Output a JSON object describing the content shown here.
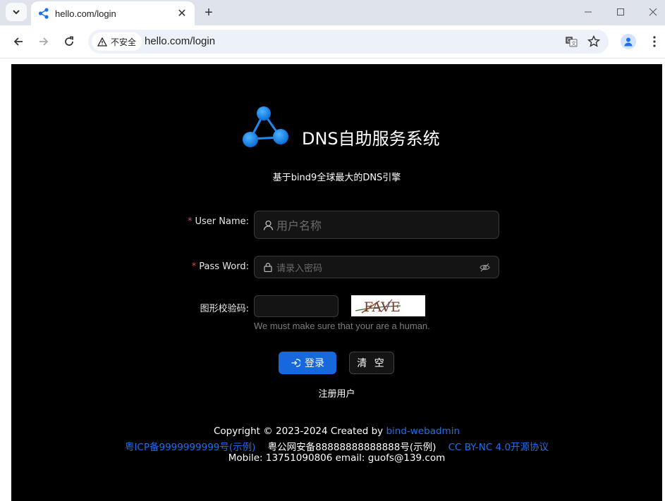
{
  "browser": {
    "tab_title": "hello.com/login",
    "security_label": "不安全",
    "url": "hello.com/login"
  },
  "login": {
    "brand": "DNS自助服务系统",
    "subtitle": "基于bind9全球最大的DNS引擎",
    "username_label": "User Name:",
    "username_placeholder": "用户名称",
    "password_label": "Pass Word:",
    "password_placeholder": "请录入密码",
    "captcha_label": "图形校验码:",
    "captcha_text": "FAVE",
    "captcha_hint": "We must make sure that your are a human.",
    "login_button": "登录",
    "clear_button": "清 空",
    "register_link": "注册用户"
  },
  "footer": {
    "copyright_prefix": "Copyright © 2023-2024 Created by",
    "creator_link": "bind-webadmin",
    "icp_link": "粤ICP备9999999999号(示例)",
    "police_record": "粤公网安备88888888888888号(示例)",
    "license_link": "CC BY-NC 4.0开源协议",
    "contact": "Mobile: 13751090806 email: guofs@139.com"
  }
}
